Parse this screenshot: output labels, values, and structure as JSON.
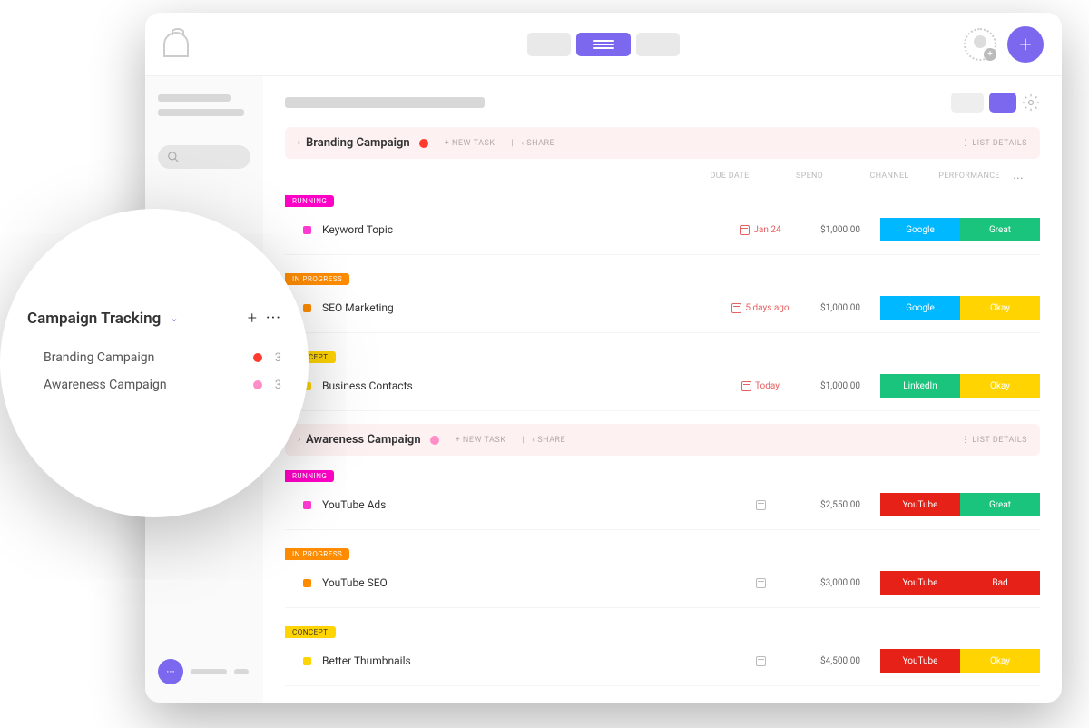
{
  "topbar": {},
  "sidebar_zoom": {
    "title": "Campaign Tracking",
    "items": [
      {
        "label": "Branding Campaign",
        "count": "3",
        "color": "red"
      },
      {
        "label": "Awareness Campaign",
        "count": "3",
        "color": "pink"
      }
    ]
  },
  "columns": {
    "due": "DUE DATE",
    "spend": "SPEND",
    "channel": "CHANNEL",
    "performance": "PERFORMANCE"
  },
  "campaigns": [
    {
      "name": "Branding Campaign",
      "dot": "red",
      "new_task": "+ NEW TASK",
      "share": "SHARE",
      "list_details": "LIST DETAILS",
      "groups": [
        {
          "status": "RUNNING",
          "status_class": "running",
          "task": {
            "title": "Keyword Topic",
            "sq": "pink",
            "due": "Jan 24",
            "due_class": "red",
            "spend": "$1,000.00",
            "channel": "Google",
            "channel_class": "google",
            "perf": "Great",
            "perf_class": "great"
          }
        },
        {
          "status": "IN PROGRESS",
          "status_class": "inprogress",
          "task": {
            "title": "SEO Marketing",
            "sq": "orange",
            "due": "5 days ago",
            "due_class": "red",
            "spend": "$1,000.00",
            "channel": "Google",
            "channel_class": "google",
            "perf": "Okay",
            "perf_class": "okay"
          }
        },
        {
          "status": "CONCEPT",
          "status_class": "concept",
          "task": {
            "title": "Business Contacts",
            "sq": "yellow",
            "due": "Today",
            "due_class": "red",
            "spend": "$1,000.00",
            "channel": "LinkedIn",
            "channel_class": "linkedin",
            "perf": "Okay",
            "perf_class": "okay"
          }
        }
      ]
    },
    {
      "name": "Awareness Campaign",
      "dot": "pink",
      "new_task": "+ NEW TASK",
      "share": "SHARE",
      "list_details": "LIST DETAILS",
      "groups": [
        {
          "status": "RUNNING",
          "status_class": "running",
          "task": {
            "title": "YouTube Ads",
            "sq": "pink",
            "due": "",
            "due_class": "gray",
            "spend": "$2,550.00",
            "channel": "YouTube",
            "channel_class": "youtube",
            "perf": "Great",
            "perf_class": "great"
          }
        },
        {
          "status": "IN PROGRESS",
          "status_class": "inprogress",
          "task": {
            "title": "YouTube SEO",
            "sq": "orange",
            "due": "",
            "due_class": "gray",
            "spend": "$3,000.00",
            "channel": "YouTube",
            "channel_class": "youtube",
            "perf": "Bad",
            "perf_class": "bad"
          }
        },
        {
          "status": "CONCEPT",
          "status_class": "concept",
          "task": {
            "title": "Better Thumbnails",
            "sq": "yellow",
            "due": "",
            "due_class": "gray",
            "spend": "$4,500.00",
            "channel": "YouTube",
            "channel_class": "youtube",
            "perf": "Okay",
            "perf_class": "okay"
          }
        }
      ]
    }
  ]
}
